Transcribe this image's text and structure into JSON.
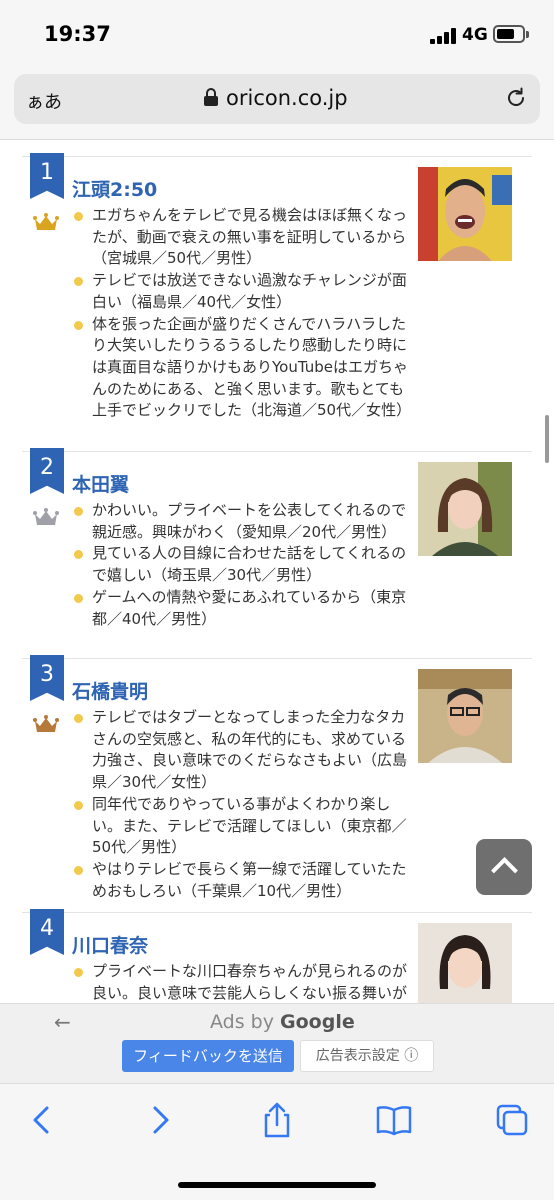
{
  "status": {
    "time": "19:37",
    "network": "4G",
    "battery_level": 0.7
  },
  "browser": {
    "aa": "ぁあ",
    "domain": "oricon.co.jp"
  },
  "entries": [
    {
      "rank": "1",
      "crown": "gold-crown",
      "name": "江頭2:50",
      "comments": [
        "エガちゃんをテレビで見る機会はほぼ無くなったが、動画で衰えの無い事を証明しているから（宮城県／50代／男性）",
        "テレビでは放送できない過激なチャレンジが面白い（福島県／40代／女性）",
        "体を張った企画が盛りだくさんでハラハラしたり大笑いしたりうるうるしたり感動したり時には真面目な語りかけもありYouTubeはエガちゃんのためにある、と強く思います。歌もとても上手でビックリでした（北海道／50代／女性）"
      ]
    },
    {
      "rank": "2",
      "crown": "silver-crown",
      "name": "本田翼",
      "comments": [
        "かわいい。プライベートを公表してくれるので親近感。興味がわく（愛知県／20代／男性）",
        "見ている人の目線に合わせた話をしてくれるので嬉しい（埼玉県／30代／男性）",
        "ゲームへの情熱や愛にあふれているから（東京都／40代／男性）"
      ]
    },
    {
      "rank": "3",
      "crown": "bronze-crown",
      "name": "石橋貴明",
      "comments": [
        "テレビではタブーとなってしまった全力なタカさんの空気感と、私の年代的にも、求めている力強さ、良い意味でのくだらなさもよい（広島県／30代／女性）",
        "同年代でありやっている事がよくわかり楽しい。また、テレビで活躍してほしい（東京都／50代／男性）",
        "やはりテレビで長らく第一線で活躍していたためおもしろい（千葉県／10代／男性）"
      ]
    },
    {
      "rank": "4",
      "crown": "",
      "name": "川口春奈",
      "comments": [
        "プライベートな川口春奈ちゃんが見られるのが良い。良い意味で芸能人らしくない振る舞いが好き"
      ]
    }
  ],
  "ads": {
    "back": "←",
    "ads_by": "Ads by",
    "google": "Google",
    "feedback": "フィードバックを送信",
    "settings": "広告表示設定 ⓘ"
  },
  "colors": {
    "accent": "#2f64b4",
    "bullet": "#f2c94c",
    "gold": "#d9a520",
    "silver": "#a0a0a8",
    "bronze": "#b5793a",
    "ios_blue": "#3478f6"
  }
}
